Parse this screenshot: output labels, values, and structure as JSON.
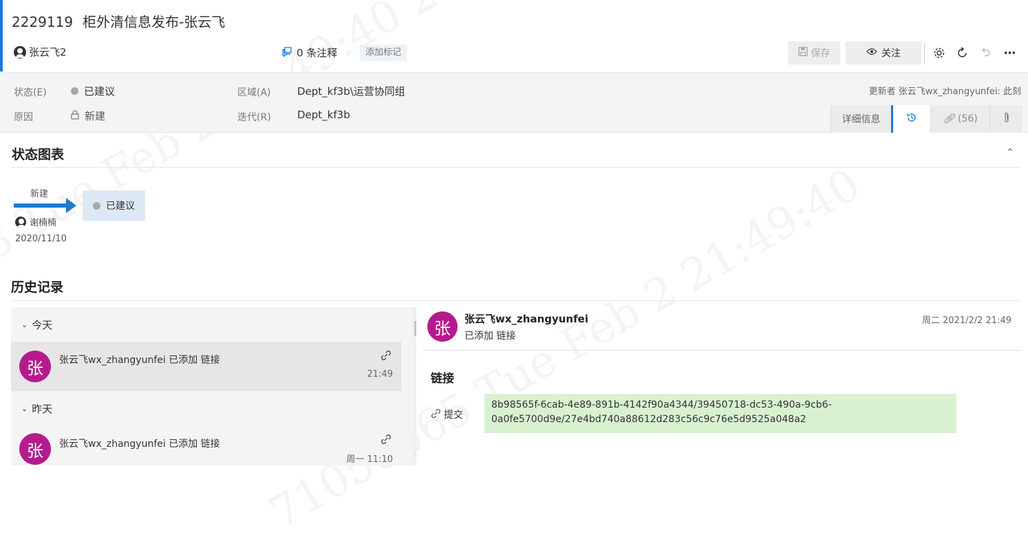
{
  "work_item": {
    "id": "2229119",
    "title": "柜外清信息发布-张云飞",
    "owner": "张云飞2",
    "comments_label": "0 条注释",
    "add_tag_label": "添加标记"
  },
  "toolbar": {
    "save_label": "保存",
    "follow_label": "关注",
    "settings_icon": "gear-icon",
    "refresh_icon": "refresh-icon",
    "undo_icon": "undo-icon",
    "more_label": "···"
  },
  "fields": {
    "state_label": "状态(E)",
    "state_value": "已建议",
    "reason_label": "原因",
    "reason_value": "新建",
    "area_label": "区域(A)",
    "area_value": "Dept_kf3b\\运营协同组",
    "iteration_label": "迭代(R)",
    "iteration_value": "Dept_kf3b",
    "updated_text": "更新者 张云飞wx_zhangyunfei: 此刻"
  },
  "detail_tabs": {
    "details_label": "详细信息",
    "links_label": "(56)"
  },
  "state_chart": {
    "title": "状态图表",
    "transition_from": "新建",
    "state": "已建议",
    "user": "谢楠楠",
    "date": "2020/11/10"
  },
  "history": {
    "title": "历史记录",
    "groups": [
      {
        "label": "今天",
        "items": [
          {
            "avatar": "张",
            "text": "张云飞wx_zhangyunfei 已添加 链接",
            "time": "21:49"
          }
        ]
      },
      {
        "label": "昨天",
        "items": [
          {
            "avatar": "张",
            "text": "张云飞wx_zhangyunfei 已添加 链接",
            "time": "周一 11:10"
          }
        ]
      }
    ],
    "detail": {
      "avatar": "张",
      "name": "张云飞wx_zhangyunfei",
      "action": "已添加 链接",
      "time": "周二 2021/2/2 21:49",
      "section": "链接",
      "commit_label": "提交",
      "commit_line1": "8b98565f-6cab-4e89-891b-4142f90a4344/39450718-dc53-490a-9cb6-",
      "commit_line2": "0a0fe5700d9e/27e4bd740a88612d283c56c9c76e5d9525a048a2"
    }
  },
  "colors": {
    "accent": "#1a7bd6",
    "avatar": "#b51b8c",
    "commit_bg": "#d8f2d0",
    "state_box": "#dce9f5"
  }
}
